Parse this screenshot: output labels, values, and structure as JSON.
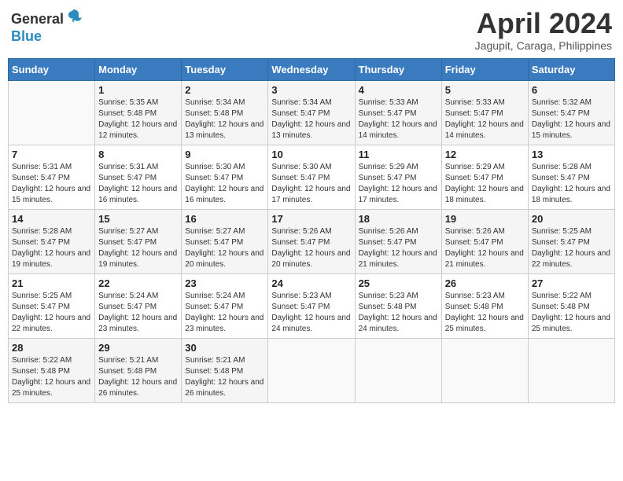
{
  "header": {
    "logo_general": "General",
    "logo_blue": "Blue",
    "month_title": "April 2024",
    "location": "Jagupit, Caraga, Philippines"
  },
  "days_of_week": [
    "Sunday",
    "Monday",
    "Tuesday",
    "Wednesday",
    "Thursday",
    "Friday",
    "Saturday"
  ],
  "weeks": [
    [
      {
        "day": "",
        "sunrise": "",
        "sunset": "",
        "daylight": ""
      },
      {
        "day": "1",
        "sunrise": "Sunrise: 5:35 AM",
        "sunset": "Sunset: 5:48 PM",
        "daylight": "Daylight: 12 hours and 12 minutes."
      },
      {
        "day": "2",
        "sunrise": "Sunrise: 5:34 AM",
        "sunset": "Sunset: 5:48 PM",
        "daylight": "Daylight: 12 hours and 13 minutes."
      },
      {
        "day": "3",
        "sunrise": "Sunrise: 5:34 AM",
        "sunset": "Sunset: 5:47 PM",
        "daylight": "Daylight: 12 hours and 13 minutes."
      },
      {
        "day": "4",
        "sunrise": "Sunrise: 5:33 AM",
        "sunset": "Sunset: 5:47 PM",
        "daylight": "Daylight: 12 hours and 14 minutes."
      },
      {
        "day": "5",
        "sunrise": "Sunrise: 5:33 AM",
        "sunset": "Sunset: 5:47 PM",
        "daylight": "Daylight: 12 hours and 14 minutes."
      },
      {
        "day": "6",
        "sunrise": "Sunrise: 5:32 AM",
        "sunset": "Sunset: 5:47 PM",
        "daylight": "Daylight: 12 hours and 15 minutes."
      }
    ],
    [
      {
        "day": "7",
        "sunrise": "Sunrise: 5:31 AM",
        "sunset": "Sunset: 5:47 PM",
        "daylight": "Daylight: 12 hours and 15 minutes."
      },
      {
        "day": "8",
        "sunrise": "Sunrise: 5:31 AM",
        "sunset": "Sunset: 5:47 PM",
        "daylight": "Daylight: 12 hours and 16 minutes."
      },
      {
        "day": "9",
        "sunrise": "Sunrise: 5:30 AM",
        "sunset": "Sunset: 5:47 PM",
        "daylight": "Daylight: 12 hours and 16 minutes."
      },
      {
        "day": "10",
        "sunrise": "Sunrise: 5:30 AM",
        "sunset": "Sunset: 5:47 PM",
        "daylight": "Daylight: 12 hours and 17 minutes."
      },
      {
        "day": "11",
        "sunrise": "Sunrise: 5:29 AM",
        "sunset": "Sunset: 5:47 PM",
        "daylight": "Daylight: 12 hours and 17 minutes."
      },
      {
        "day": "12",
        "sunrise": "Sunrise: 5:29 AM",
        "sunset": "Sunset: 5:47 PM",
        "daylight": "Daylight: 12 hours and 18 minutes."
      },
      {
        "day": "13",
        "sunrise": "Sunrise: 5:28 AM",
        "sunset": "Sunset: 5:47 PM",
        "daylight": "Daylight: 12 hours and 18 minutes."
      }
    ],
    [
      {
        "day": "14",
        "sunrise": "Sunrise: 5:28 AM",
        "sunset": "Sunset: 5:47 PM",
        "daylight": "Daylight: 12 hours and 19 minutes."
      },
      {
        "day": "15",
        "sunrise": "Sunrise: 5:27 AM",
        "sunset": "Sunset: 5:47 PM",
        "daylight": "Daylight: 12 hours and 19 minutes."
      },
      {
        "day": "16",
        "sunrise": "Sunrise: 5:27 AM",
        "sunset": "Sunset: 5:47 PM",
        "daylight": "Daylight: 12 hours and 20 minutes."
      },
      {
        "day": "17",
        "sunrise": "Sunrise: 5:26 AM",
        "sunset": "Sunset: 5:47 PM",
        "daylight": "Daylight: 12 hours and 20 minutes."
      },
      {
        "day": "18",
        "sunrise": "Sunrise: 5:26 AM",
        "sunset": "Sunset: 5:47 PM",
        "daylight": "Daylight: 12 hours and 21 minutes."
      },
      {
        "day": "19",
        "sunrise": "Sunrise: 5:26 AM",
        "sunset": "Sunset: 5:47 PM",
        "daylight": "Daylight: 12 hours and 21 minutes."
      },
      {
        "day": "20",
        "sunrise": "Sunrise: 5:25 AM",
        "sunset": "Sunset: 5:47 PM",
        "daylight": "Daylight: 12 hours and 22 minutes."
      }
    ],
    [
      {
        "day": "21",
        "sunrise": "Sunrise: 5:25 AM",
        "sunset": "Sunset: 5:47 PM",
        "daylight": "Daylight: 12 hours and 22 minutes."
      },
      {
        "day": "22",
        "sunrise": "Sunrise: 5:24 AM",
        "sunset": "Sunset: 5:47 PM",
        "daylight": "Daylight: 12 hours and 23 minutes."
      },
      {
        "day": "23",
        "sunrise": "Sunrise: 5:24 AM",
        "sunset": "Sunset: 5:47 PM",
        "daylight": "Daylight: 12 hours and 23 minutes."
      },
      {
        "day": "24",
        "sunrise": "Sunrise: 5:23 AM",
        "sunset": "Sunset: 5:47 PM",
        "daylight": "Daylight: 12 hours and 24 minutes."
      },
      {
        "day": "25",
        "sunrise": "Sunrise: 5:23 AM",
        "sunset": "Sunset: 5:48 PM",
        "daylight": "Daylight: 12 hours and 24 minutes."
      },
      {
        "day": "26",
        "sunrise": "Sunrise: 5:23 AM",
        "sunset": "Sunset: 5:48 PM",
        "daylight": "Daylight: 12 hours and 25 minutes."
      },
      {
        "day": "27",
        "sunrise": "Sunrise: 5:22 AM",
        "sunset": "Sunset: 5:48 PM",
        "daylight": "Daylight: 12 hours and 25 minutes."
      }
    ],
    [
      {
        "day": "28",
        "sunrise": "Sunrise: 5:22 AM",
        "sunset": "Sunset: 5:48 PM",
        "daylight": "Daylight: 12 hours and 25 minutes."
      },
      {
        "day": "29",
        "sunrise": "Sunrise: 5:21 AM",
        "sunset": "Sunset: 5:48 PM",
        "daylight": "Daylight: 12 hours and 26 minutes."
      },
      {
        "day": "30",
        "sunrise": "Sunrise: 5:21 AM",
        "sunset": "Sunset: 5:48 PM",
        "daylight": "Daylight: 12 hours and 26 minutes."
      },
      {
        "day": "",
        "sunrise": "",
        "sunset": "",
        "daylight": ""
      },
      {
        "day": "",
        "sunrise": "",
        "sunset": "",
        "daylight": ""
      },
      {
        "day": "",
        "sunrise": "",
        "sunset": "",
        "daylight": ""
      },
      {
        "day": "",
        "sunrise": "",
        "sunset": "",
        "daylight": ""
      }
    ]
  ]
}
